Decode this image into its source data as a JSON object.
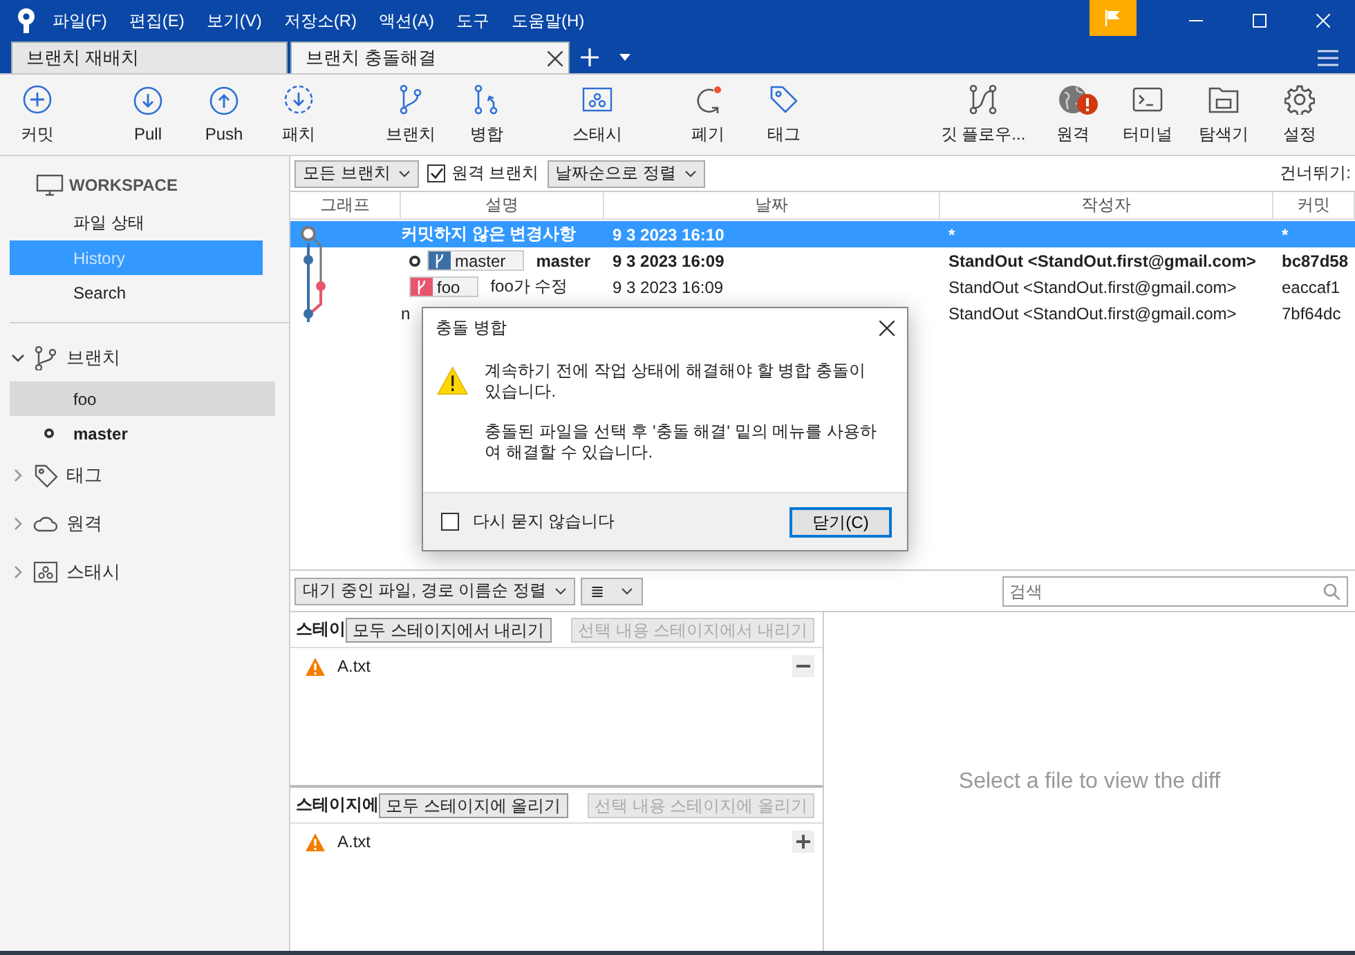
{
  "menu": [
    "파일(F)",
    "편집(E)",
    "보기(V)",
    "저장소(R)",
    "액션(A)",
    "도구",
    "도움말(H)"
  ],
  "tabs": [
    {
      "label": "브랜치 재배치",
      "selected": false
    },
    {
      "label": "브랜치 충돌해결",
      "selected": true
    }
  ],
  "toolbar": {
    "left": [
      {
        "label": "커밋"
      },
      {
        "label": "Pull"
      },
      {
        "label": "Push"
      },
      {
        "label": "패치"
      },
      {
        "label": "브랜치"
      },
      {
        "label": "병합"
      },
      {
        "label": "스태시"
      },
      {
        "label": "폐기"
      },
      {
        "label": "태그"
      }
    ],
    "right": [
      {
        "label": "깃 플로우..."
      },
      {
        "label": "원격",
        "alert": true
      },
      {
        "label": "터미널"
      },
      {
        "label": "탐색기"
      },
      {
        "label": "설정"
      }
    ]
  },
  "sidebar": {
    "workspace": {
      "title": "WORKSPACE",
      "items": [
        {
          "label": "파일 상태",
          "selected": false
        },
        {
          "label": "History",
          "selected": true
        },
        {
          "label": "Search",
          "selected": false
        }
      ]
    },
    "sections": [
      {
        "label": "브랜치",
        "expanded": true,
        "items": [
          {
            "label": "foo",
            "selected": true,
            "current": false
          },
          {
            "label": "master",
            "selected": false,
            "current": true
          }
        ]
      },
      {
        "label": "태그",
        "expanded": false
      },
      {
        "label": "원격",
        "expanded": false
      },
      {
        "label": "스태시",
        "expanded": false
      }
    ]
  },
  "filters": {
    "branches": "모든 브랜치",
    "remote_branches": {
      "label": "원격 브랜치",
      "checked": true
    },
    "sort": "날짜순으로 정렬",
    "jump": "건너뛰기:"
  },
  "table": {
    "columns": [
      "그래프",
      "설명",
      "날짜",
      "작성자",
      "커밋"
    ],
    "rows": [
      {
        "selected": true,
        "bold": true,
        "head": false,
        "labels": [],
        "description": "커밋하지 않은 변경사항",
        "date": "9 3 2023 16:10",
        "author": "*",
        "commit": "*"
      },
      {
        "selected": false,
        "bold": true,
        "head": true,
        "labels": [
          {
            "name": "master",
            "color": "#3c6fa7"
          }
        ],
        "description": "master",
        "date": "9 3 2023 16:09",
        "author": "StandOut <StandOut.first@gmail.com>",
        "commit": "bc87d58"
      },
      {
        "selected": false,
        "bold": false,
        "head": false,
        "labels": [
          {
            "name": "foo",
            "color": "#e9556f"
          }
        ],
        "description": "foo가 수정",
        "date": "9 3 2023 16:09",
        "author": "StandOut <StandOut.first@gmail.com>",
        "commit": "eaccaf1"
      },
      {
        "selected": false,
        "bold": false,
        "head": false,
        "labels": [],
        "description": "n",
        "date": "",
        "author": "StandOut <StandOut.first@gmail.com>",
        "commit": "7bf64dc"
      }
    ]
  },
  "dialog": {
    "title": "충돌 병합",
    "messages": [
      "계속하기 전에 작업 상태에 해결해야 할 병합 충돌이 있습니다.",
      "충돌된 파일을 선택 후 '충돌 해결' 밑의 메뉴를 사용하여 해결할 수 있습니다."
    ],
    "dont_ask": {
      "label": "다시 묻지 않습니다",
      "checked": false
    },
    "button": "닫기(C)"
  },
  "files_toolbar": {
    "sort": "대기 중인 파일, 경로 이름순 정렬",
    "view": "≣",
    "search": {
      "placeholder": "검색"
    }
  },
  "staged": {
    "title": "스테이",
    "all_button": {
      "label": "모두 스테이지에서 내리기",
      "disabled": false
    },
    "selected_button": {
      "label": "선택 내용 스테이지에서 내리기",
      "disabled": true
    },
    "files": [
      {
        "name": "A.txt"
      }
    ]
  },
  "unstaged": {
    "title": "스테이지에",
    "all_button": {
      "label": "모두 스테이지에 올리기",
      "disabled": false
    },
    "selected_button": {
      "label": "선택 내용 스테이지에 올리기",
      "disabled": true
    },
    "files": [
      {
        "name": "A.txt"
      }
    ]
  },
  "diff": {
    "message": "Select a file to view the diff"
  }
}
